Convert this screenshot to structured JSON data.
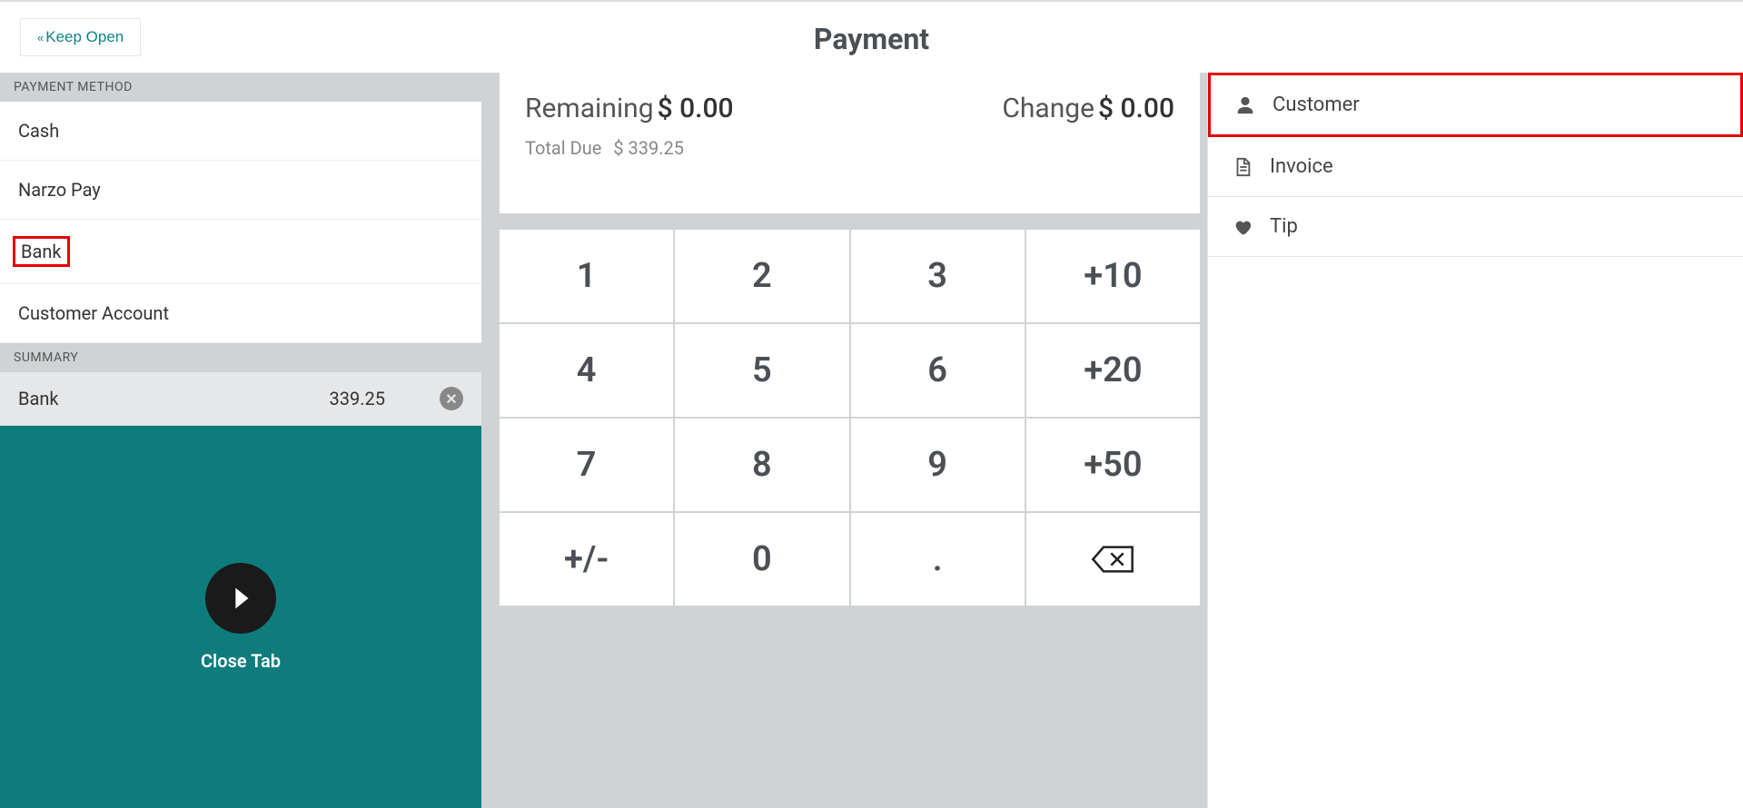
{
  "header": {
    "keep_open_label": "Keep Open",
    "title": "Payment"
  },
  "left": {
    "payment_method_header": "PAYMENT METHOD",
    "methods": [
      "Cash",
      "Narzo Pay",
      "Bank",
      "Customer Account"
    ],
    "summary_header": "SUMMARY",
    "summary_items": [
      {
        "label": "Bank",
        "amount": "339.25"
      }
    ],
    "close_tab_label": "Close Tab"
  },
  "center": {
    "remaining_label": "Remaining",
    "remaining_value": "$ 0.00",
    "change_label": "Change",
    "change_value": "$ 0.00",
    "total_due_label": "Total Due",
    "total_due_value": "$ 339.25",
    "keys": [
      "1",
      "2",
      "3",
      "+10",
      "4",
      "5",
      "6",
      "+20",
      "7",
      "8",
      "9",
      "+50",
      "+/-",
      "0",
      "."
    ]
  },
  "right": {
    "actions": [
      {
        "label": "Customer",
        "icon": "user-icon"
      },
      {
        "label": "Invoice",
        "icon": "document-icon"
      },
      {
        "label": "Tip",
        "icon": "heart-icon"
      }
    ]
  }
}
